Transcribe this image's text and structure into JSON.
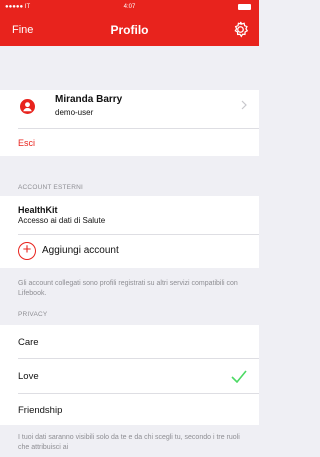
{
  "status_bar": {
    "carrier": "●●●●● IT",
    "time": "4:07"
  },
  "nav": {
    "left_label": "Fine",
    "title": "Profilo"
  },
  "profile": {
    "name": "Miranda Barry",
    "username": "demo-user",
    "logout_label": "Esci"
  },
  "external_accounts": {
    "header": "ACCOUNT ESTERNI",
    "healthkit_title": "HealthKit",
    "healthkit_subtitle": "Accesso ai dati di Salute",
    "add_account_label": "Aggiungi account",
    "note": "Gli account collegati sono profili registrati su altri servizi compatibili con Lifebook."
  },
  "privacy": {
    "header": "PRIVACY",
    "options": [
      {
        "label": "Care",
        "selected": false
      },
      {
        "label": "Love",
        "selected": true
      },
      {
        "label": "Friendship",
        "selected": false
      }
    ],
    "note": "I tuoi dati saranno visibili solo da te e da chi scegli tu, secondo i tre ruoli che attribuisci ai"
  },
  "colors": {
    "accent": "#e8231d",
    "checkmark": "#4cd964",
    "background": "#efeff4"
  }
}
